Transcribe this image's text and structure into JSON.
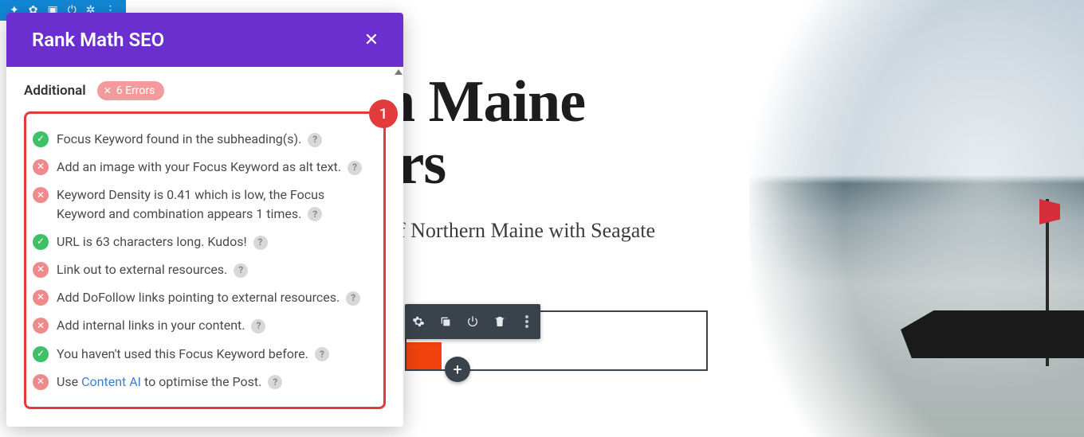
{
  "page": {
    "title_line1": "n Maine",
    "title_line2": "lrs",
    "subtitle": "f Northern Maine with Seagate"
  },
  "top_toolbar": {
    "icons": [
      "wrench-icon",
      "gear-icon",
      "duplicate-icon",
      "power-icon",
      "settings-icon",
      "handle-icon"
    ]
  },
  "panel": {
    "title": "Rank Math SEO",
    "section_title": "Additional",
    "errors_badge": "6 Errors",
    "annotation_number": "1"
  },
  "checks": [
    {
      "status": "pass",
      "text": "Focus Keyword found in the subheading(s)."
    },
    {
      "status": "fail",
      "text": "Add an image with your Focus Keyword as alt text."
    },
    {
      "status": "fail",
      "text": "Keyword Density is 0.41 which is low, the Focus Keyword and combination appears 1 times."
    },
    {
      "status": "pass",
      "text": "URL is 63 characters long. Kudos!"
    },
    {
      "status": "fail",
      "text": "Link out to external resources."
    },
    {
      "status": "fail",
      "text": "Add DoFollow links pointing to external resources."
    },
    {
      "status": "fail",
      "text": "Add internal links in your content."
    },
    {
      "status": "pass",
      "text": "You haven't used this Focus Keyword before."
    },
    {
      "status": "fail",
      "text_pre": "Use ",
      "link_text": "Content AI",
      "text_post": " to optimise the Post."
    }
  ],
  "block_toolbar": {
    "items": [
      "settings",
      "duplicate",
      "power",
      "delete",
      "more"
    ]
  }
}
